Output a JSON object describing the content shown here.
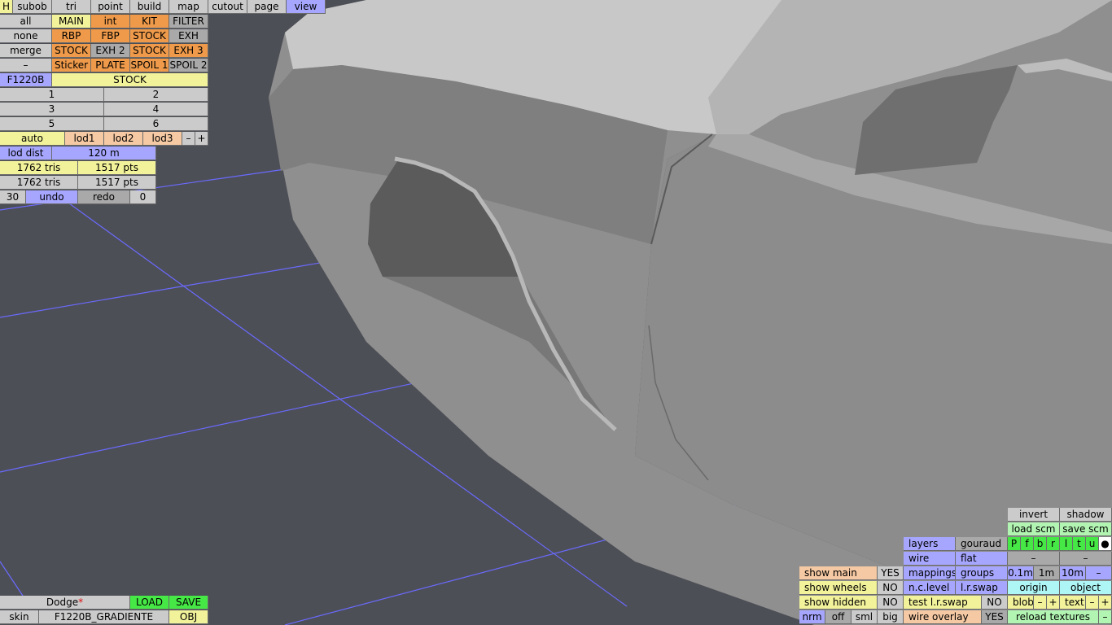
{
  "colors": {
    "background": "#4d4f56",
    "grid_lines": "#6a6aff",
    "model": "#9a9a9a"
  },
  "topbar": {
    "h": "H",
    "tabs": [
      "subob",
      "tri",
      "point",
      "build",
      "map",
      "cutout",
      "page",
      "view"
    ],
    "active_tab": "view"
  },
  "subobjects": {
    "row1": [
      "all",
      "MAIN",
      "int",
      "KIT",
      "FILTER"
    ],
    "row2": [
      "none",
      "RBP",
      "FBP",
      "STOCK",
      "EXH"
    ],
    "row3": [
      "merge",
      "STOCK",
      "EXH 2",
      "STOCK",
      "EXH 3"
    ],
    "row4": [
      "–",
      "Sticker",
      "PLATE",
      "SPOIL 1",
      "SPOIL 2"
    ]
  },
  "model_row": {
    "name": "F1220B",
    "variant": "STOCK"
  },
  "numbers": [
    "1",
    "2",
    "3",
    "4",
    "5",
    "6"
  ],
  "lod": {
    "auto": "auto",
    "lod1": "lod1",
    "lod2": "lod2",
    "lod3": "lod3",
    "minus": "–",
    "plus": "+"
  },
  "lod_dist": {
    "label": "lod dist",
    "value": "120 m"
  },
  "stats": {
    "row1_tris": "1762 tris",
    "row1_pts": "1517 pts",
    "row2_tris": "1762 tris",
    "row2_pts": "1517 pts"
  },
  "history": {
    "count": "30",
    "undo": "undo",
    "redo": "redo",
    "redo_count": "0"
  },
  "file": {
    "name": "Dodge",
    "modified_mark": "*",
    "load": "LOAD",
    "save": "SAVE",
    "skin_label": "skin",
    "skin_value": "F1220B_GRADIENTE",
    "obj": "OBJ"
  },
  "view_panel": {
    "invert": "invert",
    "shadow": "shadow",
    "load_scm": "load scm",
    "save_scm": "save scm",
    "layers": "layers",
    "gouraud": "gouraud",
    "flags": [
      "P",
      "f",
      "b",
      "r",
      "l",
      "t",
      "u",
      "●"
    ],
    "wire": "wire",
    "flat": "flat",
    "dash1": "–",
    "dash2": "–",
    "show_main": "show main",
    "show_main_val": "YES",
    "mappings": "mappings",
    "groups": "groups",
    "grid_01": "0.1m",
    "grid_1": "1m",
    "grid_10": "10m",
    "grid_dash": "–",
    "show_wheels": "show wheels",
    "show_wheels_val": "NO",
    "nc_level": "n.c.level",
    "lr_swap": "l.r.swap",
    "origin": "origin",
    "object": "object",
    "show_hidden": "show hidden",
    "show_hidden_val": "NO",
    "test_lr_swap": "test l.r.swap",
    "test_lr_swap_val": "NO",
    "blob": "blob",
    "blob_minus": "–",
    "blob_plus": "+",
    "text": "text",
    "text_minus": "–",
    "text_plus": "+",
    "nrm": "nrm",
    "off": "off",
    "sml": "sml",
    "big": "big",
    "wire_overlay": "wire overlay",
    "wire_overlay_val": "YES",
    "reload_textures": "reload textures",
    "reload_minus": "–"
  }
}
